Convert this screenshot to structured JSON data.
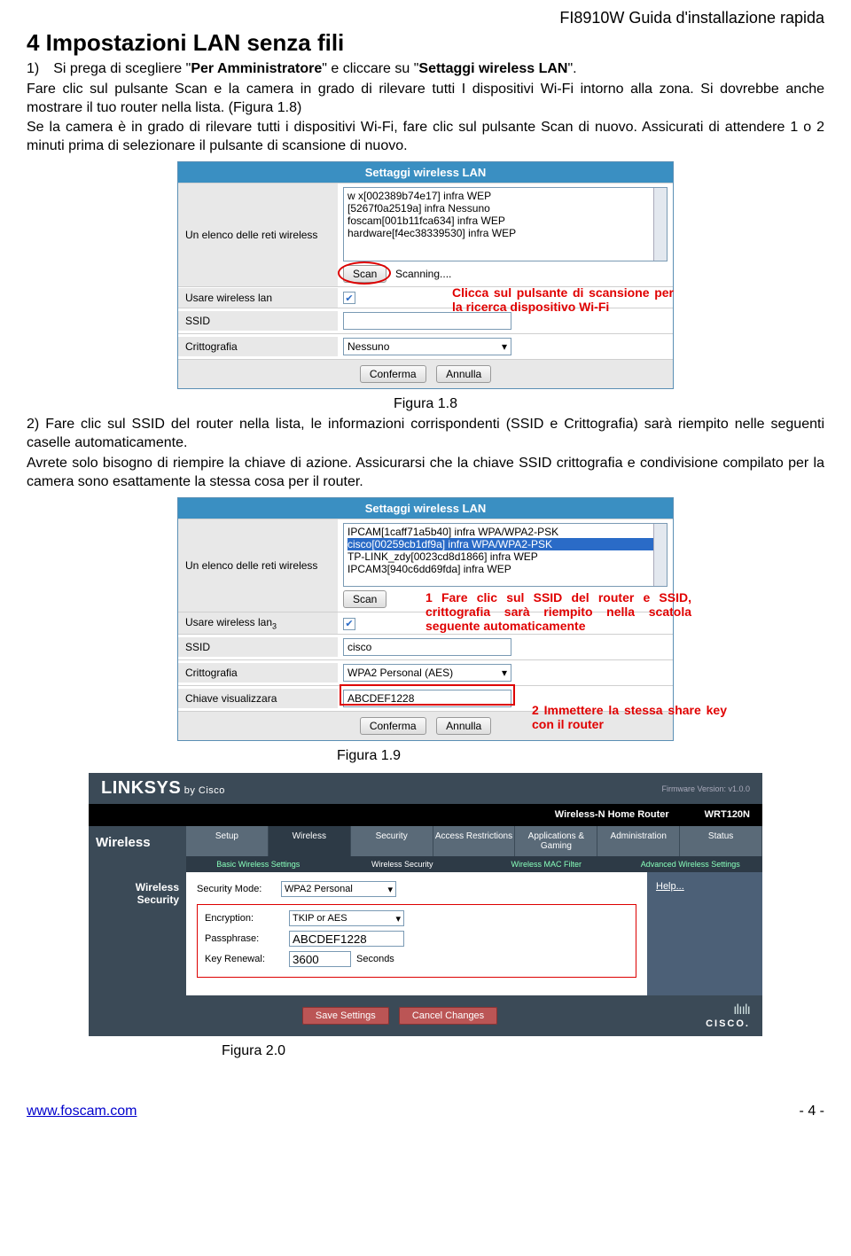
{
  "doc_header": "FI8910W Guida d'installazione rapida",
  "section_title": "4 Impostazioni LAN senza fili",
  "para1a": "1) Si prega di scegliere \"",
  "para1b": "Per Amministratore",
  "para1c": "\" e cliccare su \"",
  "para1d": "Settaggi wireless LAN",
  "para1e": "\".",
  "para2": "Fare clic sul pulsante Scan e la camera in grado di rilevare tutti I dispositivi Wi-Fi intorno alla zona. Si dovrebbe anche mostrare il tuo router nella lista. (Figura 1.8)",
  "para3": "Se la camera è in grado di rilevare tutti i dispositivi Wi-Fi, fare clic sul pulsante Scan di nuovo. Assicurati di attendere 1 o 2 minuti prima di selezionare il pulsante di scansione di nuovo.",
  "fig1": {
    "title": "Settaggi wireless LAN",
    "row_list_label": "Un elenco delle reti wireless",
    "networks": [
      "w x[002389b74e17] infra WEP",
      "[5267f0a2519a] infra Nessuno",
      "foscam[001b11fca634] infra WEP",
      "hardware[f4ec38339530] infra WEP"
    ],
    "scan_btn": "Scan",
    "scanning": "Scanning....",
    "row_use": "Usare wireless lan",
    "row_ssid": "SSID",
    "ssid_value": "",
    "row_critt": "Crittografia",
    "critt_value": "Nessuno",
    "conferma": "Conferma",
    "annulla": "Annulla",
    "callout": "Clicca sul pulsante di scansione per la ricerca dispositivo Wi-Fi"
  },
  "figcap1": "Figura 1.8",
  "para4": "2) Fare clic sul SSID del router nella lista, le informazioni corrispondenti (SSID e Crittografia) sarà riempito nelle seguenti caselle automaticamente.",
  "para5": "Avrete solo bisogno di riempire la chiave di azione. Assicurarsi che la chiave SSID crittografia e condivisione compilato per la camera sono esattamente la stessa cosa per il router.",
  "fig2": {
    "title": "Settaggi wireless LAN",
    "row_list_label": "Un elenco delle reti wireless",
    "networks": [
      "IPCAM[1caff71a5b40] infra WPA/WPA2-PSK",
      "cisco[00259cb1df9a] infra WPA/WPA2-PSK",
      "TP-LINK_zdy[0023cd8d1866] infra WEP",
      "IPCAM3[940c6dd69fda] infra WEP"
    ],
    "scan_btn": "Scan",
    "row_use": "Usare wireless lan",
    "use_sub": "3",
    "row_ssid": "SSID",
    "ssid_value": "cisco",
    "row_critt": "Crittografia",
    "critt_value": "WPA2 Personal (AES)",
    "row_key": "Chiave visualizzara",
    "key_value": "ABCDEF1228",
    "conferma": "Conferma",
    "annulla": "Annulla",
    "callout1": "1 Fare clic sul SSID del router e SSID, crittografia sarà riempito nella scatola seguente automaticamente",
    "callout2": "2 Immettere la stessa share key con il router"
  },
  "figcap2": "Figura 1.9",
  "linksys": {
    "brand": "LINKSYS",
    "by": "by Cisco",
    "fw": "Firmware Version: v1.0.0",
    "bar_left": "Wireless-N Home Router",
    "bar_right": "WRT120N",
    "side": "Wireless",
    "tabs1": [
      "Setup",
      "Wireless",
      "Security",
      "Access Restrictions",
      "Applications & Gaming",
      "Administration",
      "Status"
    ],
    "tabs2": [
      "Basic Wireless Settings",
      "Wireless Security",
      "Wireless MAC Filter",
      "Advanced Wireless Settings"
    ],
    "left_label": "Wireless Security",
    "secmode_lbl": "Security Mode:",
    "secmode_val": "WPA2 Personal",
    "enc_lbl": "Encryption:",
    "enc_val": "TKIP or AES",
    "pass_lbl": "Passphrase:",
    "pass_val": "ABCDEF1228",
    "key_lbl": "Key Renewal:",
    "key_val": "3600",
    "key_unit": "Seconds",
    "help": "Help...",
    "save": "Save Settings",
    "cancel": "Cancel Changes",
    "cisco_bars": "ılıılı",
    "cisco_txt": "CISCO."
  },
  "figcap3": "Figura 2.0",
  "footer_url": "www.foscam.com",
  "footer_page": "- 4 -"
}
